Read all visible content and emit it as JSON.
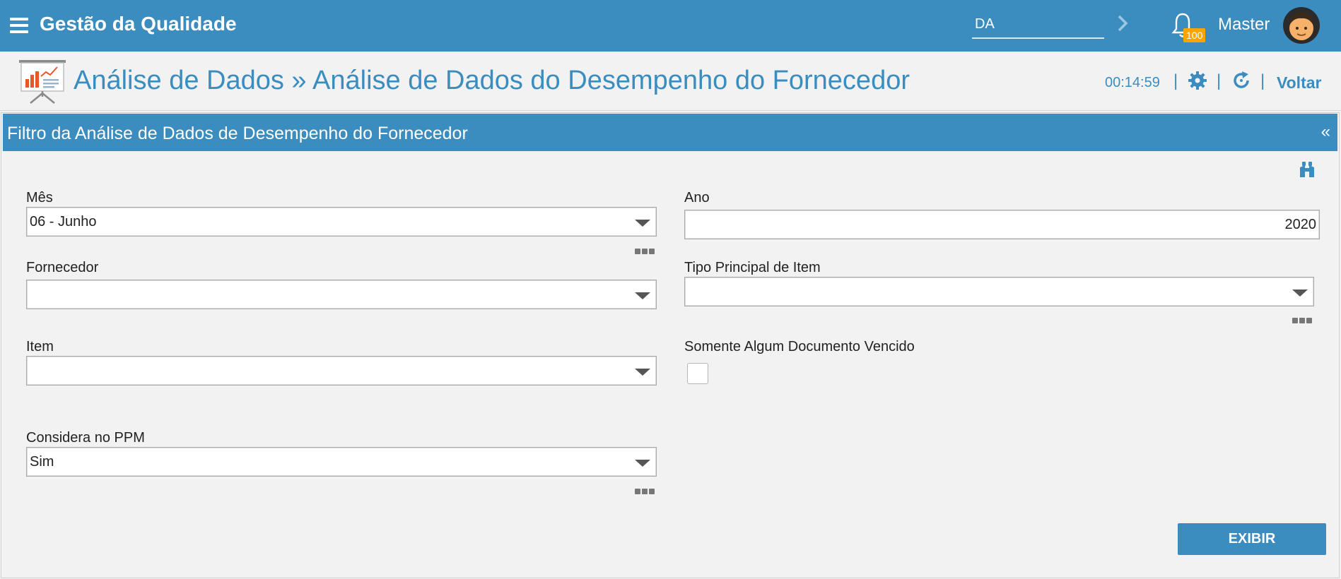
{
  "topbar": {
    "app_title": "Gestão da Qualidade",
    "search_value": "DA",
    "notification_count": "100",
    "username": "Master",
    "colors": {
      "bar": "#3b8dc0",
      "badge": "#f7a600"
    }
  },
  "page_header": {
    "title": "Análise de Dados » Análise de Dados do Desempenho do Fornecedor",
    "timer": "00:14:59",
    "separator": "|",
    "back_label": "Voltar"
  },
  "panel": {
    "title": "Filtro da Análise de Dados de Desempenho do Fornecedor",
    "collapse_label": "«"
  },
  "form": {
    "mes": {
      "label": "Mês",
      "value": "06 - Junho"
    },
    "ano": {
      "label": "Ano",
      "value": "2020"
    },
    "fornecedor": {
      "label": "Fornecedor",
      "value": ""
    },
    "tipo_principal": {
      "label": "Tipo Principal de Item",
      "value": ""
    },
    "item": {
      "label": "Item",
      "value": ""
    },
    "somente_vencido": {
      "label": "Somente Algum Documento Vencido",
      "checked": false
    },
    "considera_ppm": {
      "label": "Considera no PPM",
      "value": "Sim"
    },
    "submit_label": "EXIBIR"
  },
  "icons": [
    "menu-icon",
    "chevron-right-icon",
    "bell-icon",
    "avatar",
    "presentation-chart-icon",
    "gear-icon",
    "refresh-icon",
    "binoculars-icon",
    "ellipsis-icon",
    "dropdown-caret-icon"
  ]
}
